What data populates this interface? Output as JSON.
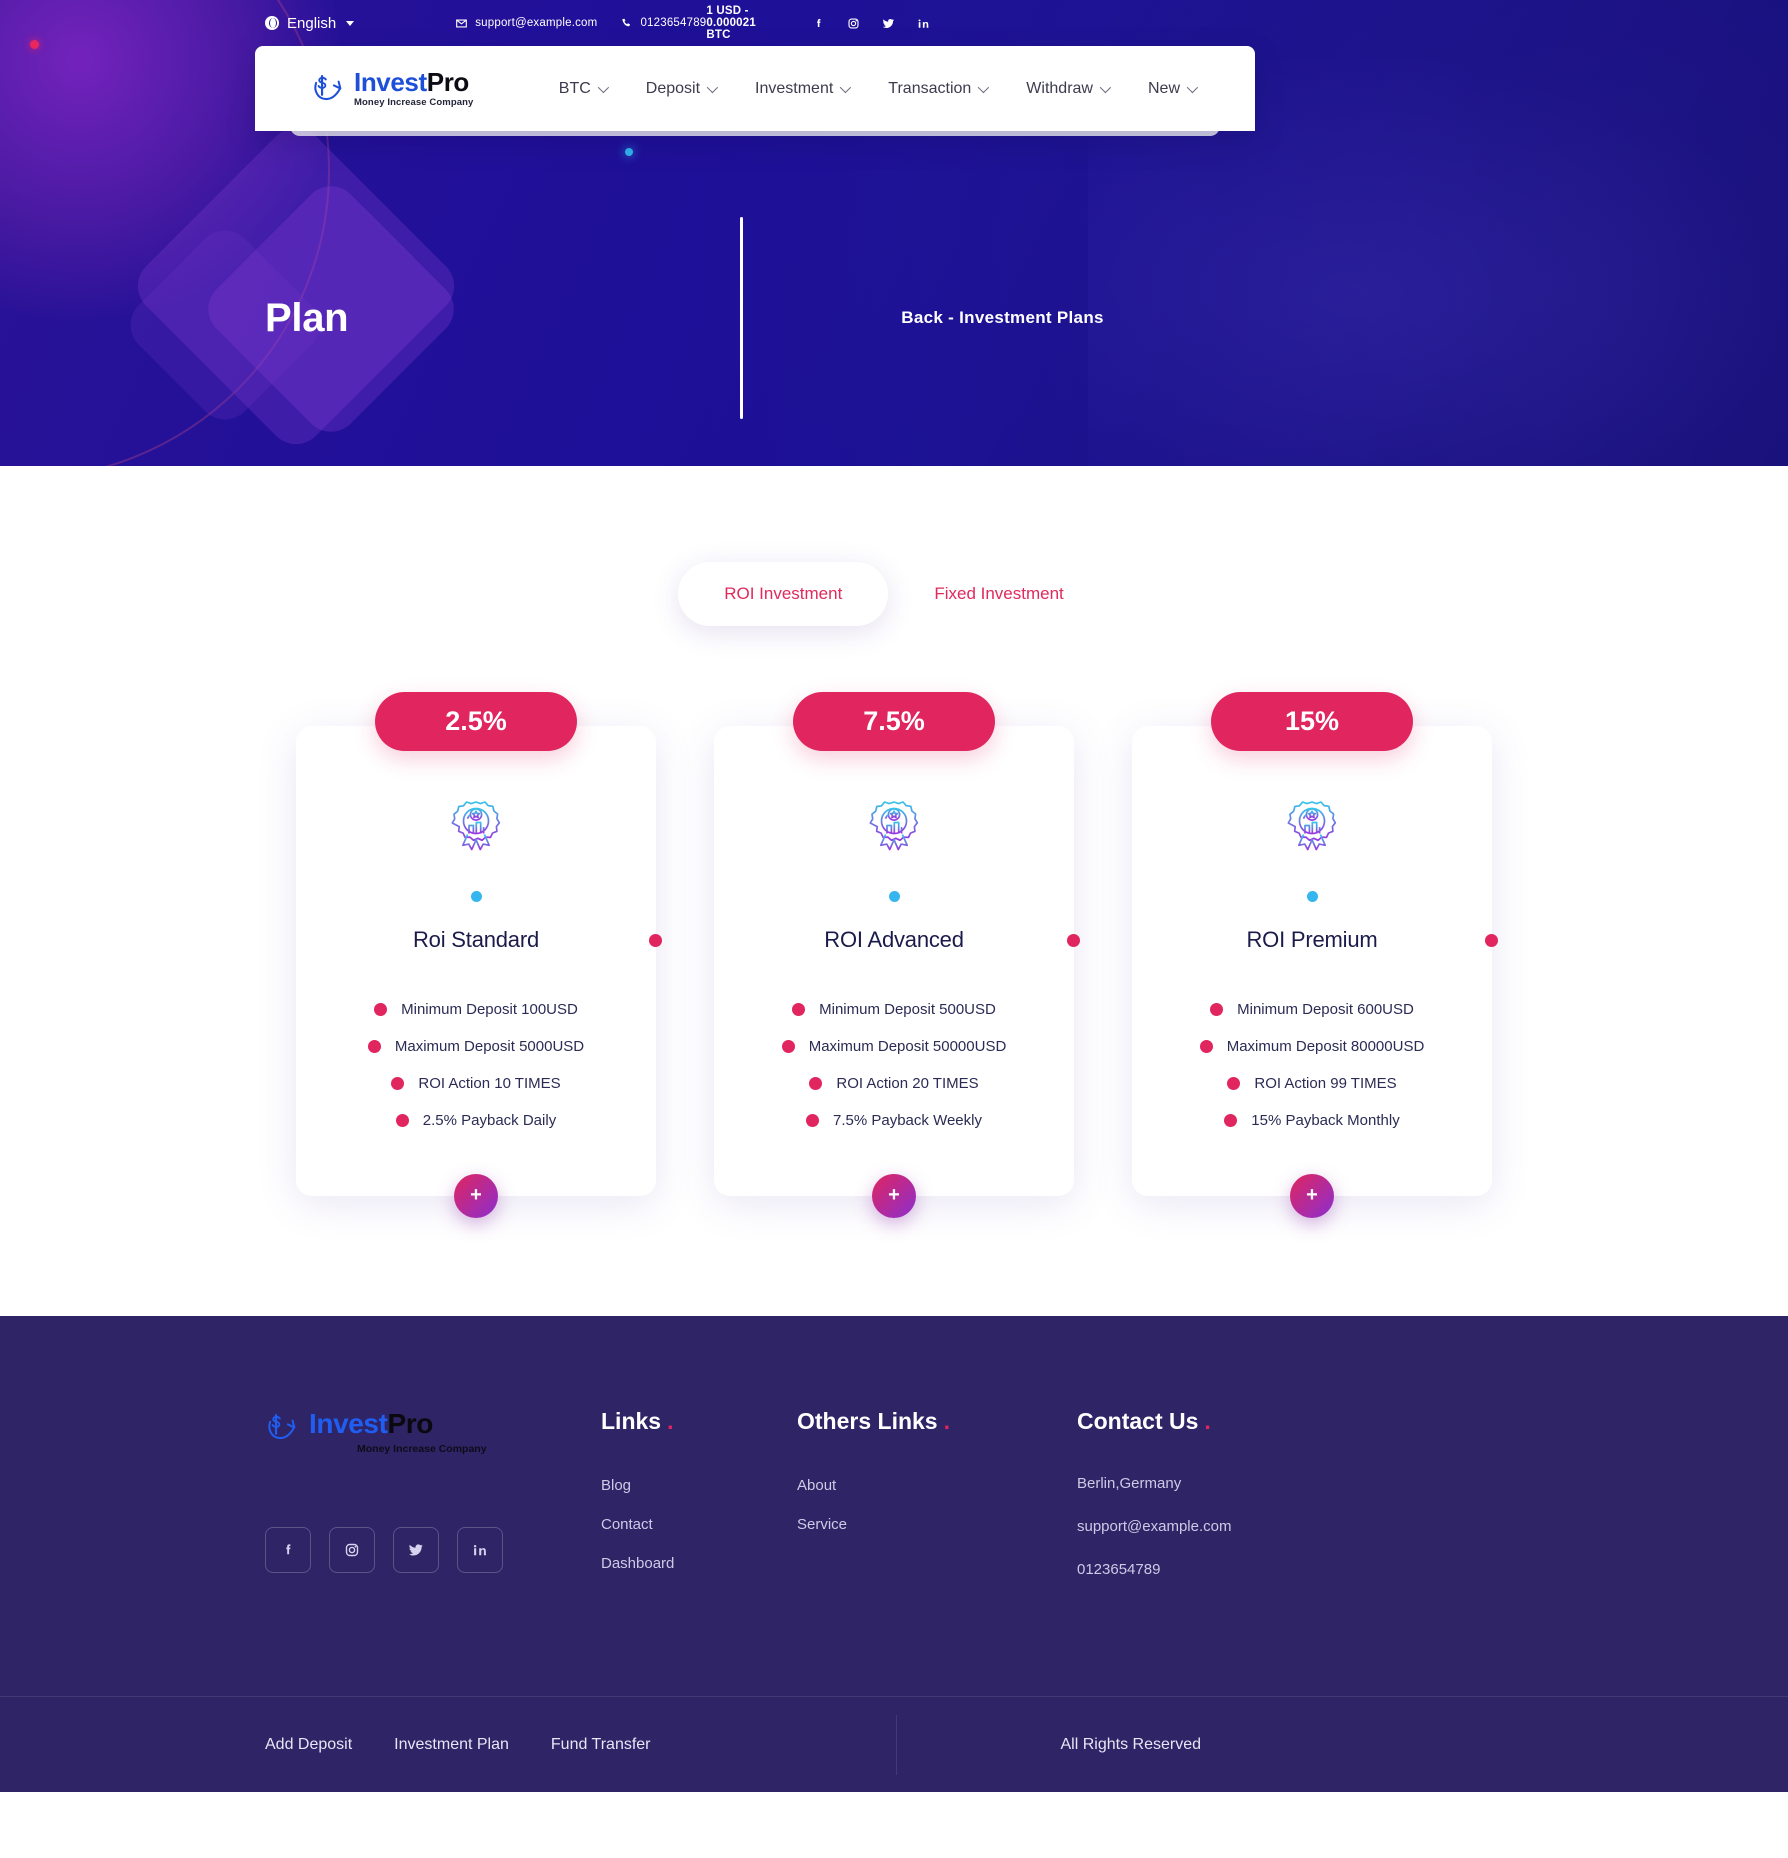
{
  "topbar": {
    "language": "English",
    "email": "support@example.com",
    "phone": "0123654789",
    "rate": "1 USD - 0.000021 BTC",
    "socials": [
      "facebook-icon",
      "instagram-icon",
      "twitter-icon",
      "linkedin-icon"
    ]
  },
  "brand": {
    "name_first": "Invest",
    "name_second": "Pro",
    "tagline": "Money Increase Company"
  },
  "nav": {
    "items": [
      {
        "label": "BTC"
      },
      {
        "label": "Deposit"
      },
      {
        "label": "Investment"
      },
      {
        "label": "Transaction"
      },
      {
        "label": "Withdraw"
      },
      {
        "label": "New"
      }
    ]
  },
  "hero": {
    "title": "Plan",
    "breadcrumb": "Back  -  Investment Plans"
  },
  "plans": {
    "tabs": [
      {
        "label": "ROI Investment",
        "active": true
      },
      {
        "label": "Fixed Investment",
        "active": false
      }
    ],
    "cards": [
      {
        "percent": "2.5%",
        "title": "Roi Standard",
        "icon": "award-badge-icon",
        "features": [
          "Minimum Deposit 100USD",
          "Maximum Deposit 5000USD",
          "ROI Action 10 TIMES",
          "2.5% Payback Daily"
        ],
        "action": "+"
      },
      {
        "percent": "7.5%",
        "title": "ROI Advanced",
        "icon": "award-badge-icon",
        "features": [
          "Minimum Deposit 500USD",
          "Maximum Deposit 50000USD",
          "ROI Action 20 TIMES",
          "7.5% Payback Weekly"
        ],
        "action": "+"
      },
      {
        "percent": "15%",
        "title": "ROI Premium",
        "icon": "award-badge-icon",
        "features": [
          "Minimum Deposit 600USD",
          "Maximum Deposit 80000USD",
          "ROI Action 99 TIMES",
          "15% Payback Monthly"
        ],
        "action": "+"
      }
    ]
  },
  "footer": {
    "links_heading": "Links",
    "links": [
      "Blog",
      "Contact",
      "Dashboard"
    ],
    "others_heading": "Others Links",
    "others": [
      "About",
      "Service"
    ],
    "contact_heading": "Contact Us",
    "contact": [
      "Berlin,Germany",
      "support@example.com",
      "0123654789"
    ],
    "socials": [
      "facebook-icon",
      "instagram-icon",
      "twitter-icon",
      "linkedin-icon"
    ],
    "bottom_links": [
      "Add Deposit",
      "Investment Plan",
      "Fund Transfer"
    ],
    "rights": "All Rights Reserved"
  },
  "colors": {
    "accent_pink": "#e0255f",
    "brand_blue": "#1d4fd8",
    "hero_bg": "#1b1096",
    "footer_bg": "#2e2466",
    "dot_blue": "#36b6ef"
  }
}
